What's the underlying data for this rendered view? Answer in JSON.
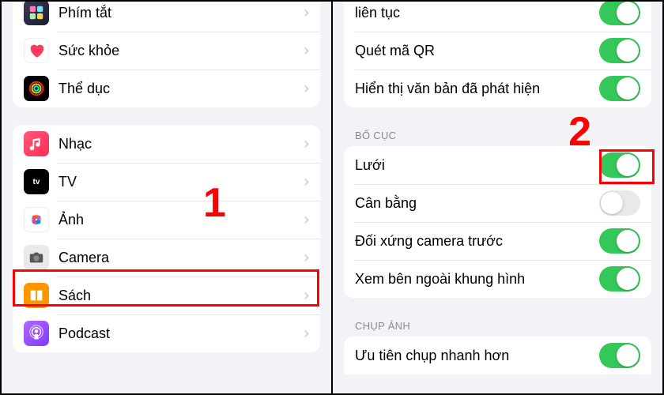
{
  "left": {
    "group1": [
      {
        "label": "Phím tắt"
      },
      {
        "label": "Sức khỏe"
      },
      {
        "label": "Thể dục"
      }
    ],
    "group2": [
      {
        "label": "Nhạc"
      },
      {
        "label": "TV"
      },
      {
        "label": "Ảnh"
      },
      {
        "label": "Camera"
      },
      {
        "label": "Sách"
      },
      {
        "label": "Podcast"
      }
    ]
  },
  "right": {
    "group1": [
      {
        "label": "liên tục",
        "on": true
      },
      {
        "label": "Quét mã QR",
        "on": true
      },
      {
        "label": "Hiển thị văn bản đã phát hiện",
        "on": true
      }
    ],
    "section2_header": "BỐ CỤC",
    "group2": [
      {
        "label": "Lưới",
        "on": true
      },
      {
        "label": "Cân bằng",
        "on": false
      },
      {
        "label": "Đối xứng camera trước",
        "on": true
      },
      {
        "label": "Xem bên ngoài khung hình",
        "on": true
      }
    ],
    "section3_header": "CHỤP ẢNH",
    "group3": [
      {
        "label": "Ưu tiên chụp nhanh hơn",
        "on": true
      }
    ]
  },
  "annotations": {
    "step1": "1",
    "step2": "2"
  }
}
